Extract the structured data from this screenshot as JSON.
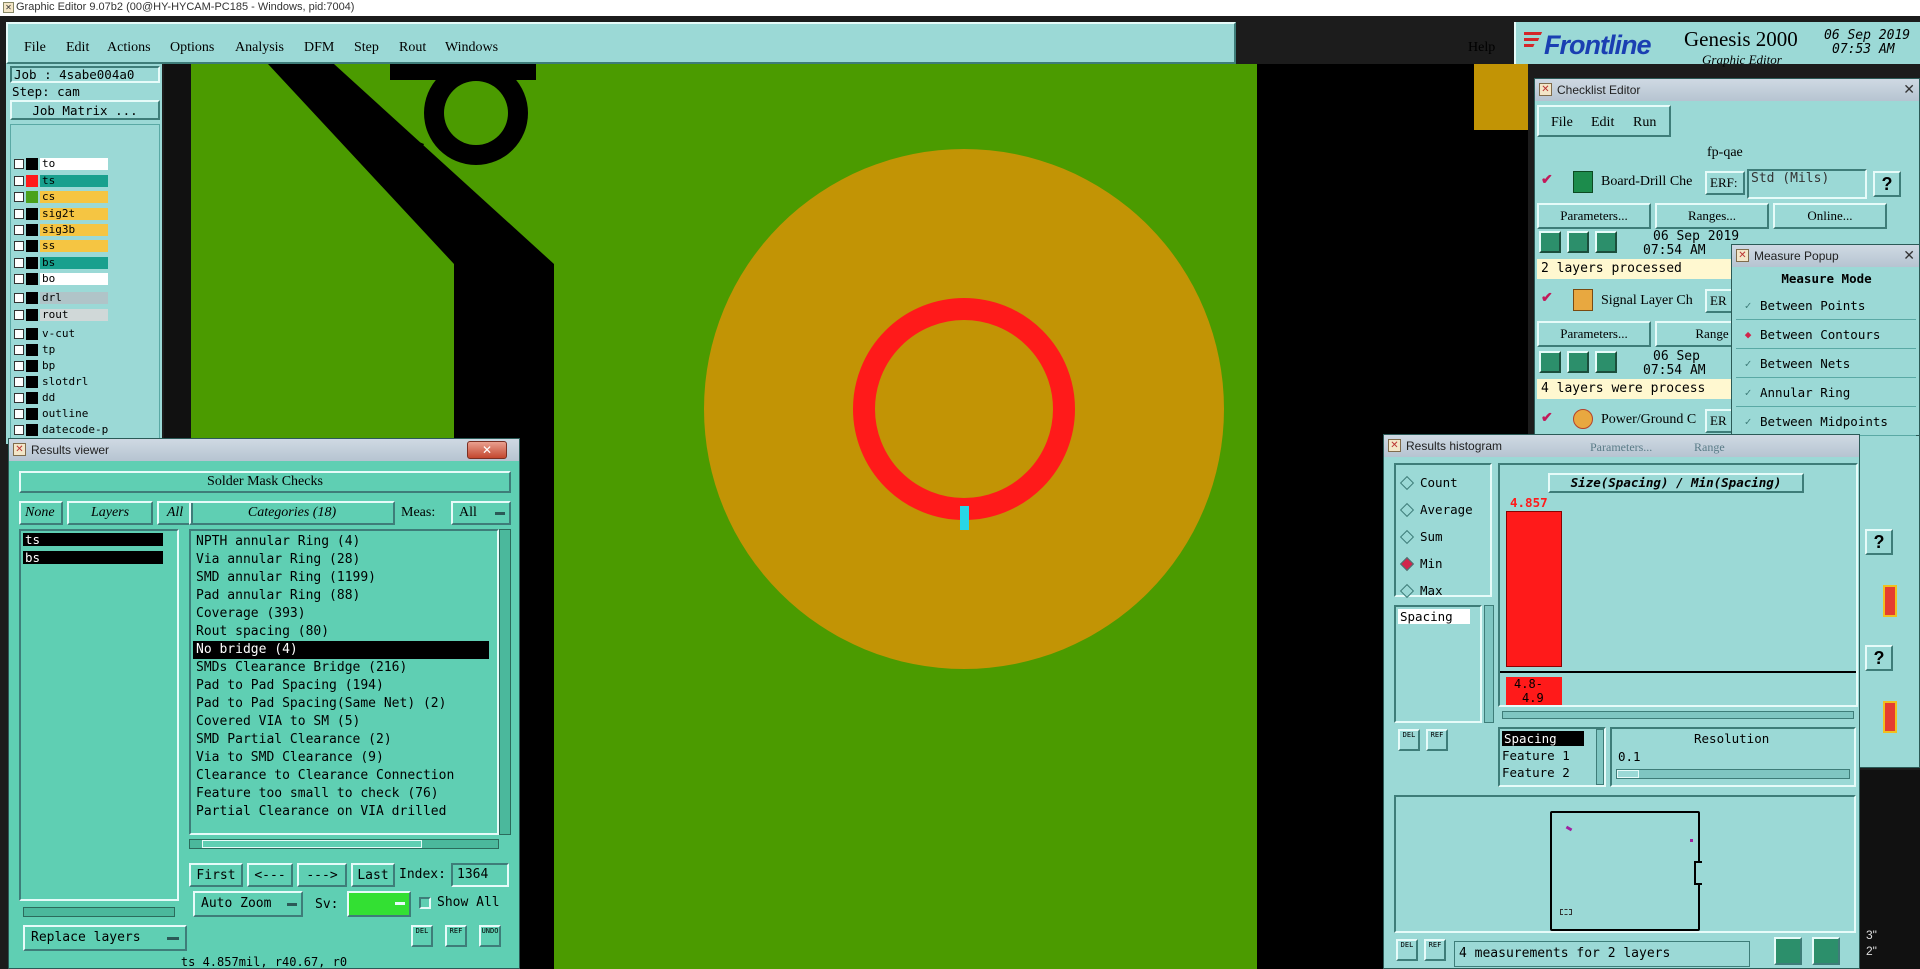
{
  "window": {
    "title": "Graphic Editor 9.07b2 (00@HY-HYCAM-PC185 - Windows, pid:7004)"
  },
  "menu": {
    "items": [
      "File",
      "Edit",
      "Actions",
      "Options",
      "Analysis",
      "DFM",
      "Step",
      "Rout",
      "Windows"
    ],
    "help": "Help"
  },
  "brand": {
    "logo": "Frontline",
    "product": "Genesis 2000",
    "subtitle": "Graphic Editor",
    "date": "06 Sep 2019",
    "time": "07:53 AM"
  },
  "job": {
    "job_label": "Job : 4sabe004a0",
    "step_label": "Step: cam",
    "matrix_button": "Job Matrix ..."
  },
  "layers": [
    {
      "name": "to",
      "color": "#ffffff",
      "swatch": "#000000"
    },
    {
      "name": "ts",
      "color": "#18a08e",
      "swatch": "#ff1a1a"
    },
    {
      "name": "cs",
      "color": "#f5c542",
      "swatch": "#4aa21c"
    },
    {
      "name": "sig2t",
      "color": "#f5c542",
      "swatch": "#000000"
    },
    {
      "name": "sig3b",
      "color": "#f5c542",
      "swatch": "#000000"
    },
    {
      "name": "ss",
      "color": "#f5c542",
      "swatch": "#000000"
    },
    {
      "name": "bs",
      "color": "#18a08e",
      "swatch": "#000000"
    },
    {
      "name": "bo",
      "color": "#ffffff",
      "swatch": "#000000"
    },
    {
      "name": "drl",
      "color": "#b0c4c8",
      "swatch": "#000000"
    },
    {
      "name": "rout",
      "color": "#d0d8d8",
      "swatch": "#000000"
    },
    {
      "name": "v-cut",
      "color": "#9bd9d6",
      "swatch": "#000000"
    },
    {
      "name": "tp",
      "color": "#9bd9d6",
      "swatch": "#000000"
    },
    {
      "name": "bp",
      "color": "#9bd9d6",
      "swatch": "#000000"
    },
    {
      "name": "slotdrl",
      "color": "#9bd9d6",
      "swatch": "#000000"
    },
    {
      "name": "dd",
      "color": "#9bd9d6",
      "swatch": "#000000"
    },
    {
      "name": "outline",
      "color": "#9bd9d6",
      "swatch": "#000000"
    },
    {
      "name": "datecode-pt",
      "color": "#9bd9d6",
      "swatch": "#000000"
    }
  ],
  "results_viewer": {
    "title": "Results viewer",
    "header": "Solder Mask Checks",
    "layer_tabs": {
      "none": "None",
      "layers": "Layers",
      "all": "All"
    },
    "layer_list": [
      "ts",
      "bs"
    ],
    "categories_label": "Categories (18)",
    "meas_label": "Meas:",
    "meas_value": "All",
    "categories": [
      "NPTH annular Ring (4)",
      "Via annular Ring (28)",
      "SMD annular Ring (1199)",
      "Pad annular Ring (88)",
      "Coverage (393)",
      "Rout spacing (80)",
      "No bridge (4)",
      "SMDs Clearance Bridge (216)",
      "Pad to Pad Spacing (194)",
      "Pad to Pad Spacing(Same Net) (2)",
      "Covered VIA to SM (5)",
      "SMD Partial Clearance (2)",
      "Via to SMD Clearance (9)",
      "Clearance to Clearance Connection",
      "Feature too small to check (76)",
      "Partial Clearance on VIA drilled"
    ],
    "selected_category": "No bridge (4)",
    "nav": {
      "first": "First",
      "prev": "<---",
      "next": "--->",
      "last": "Last",
      "index_label": "Index:",
      "index_value": "1364"
    },
    "zoom": "Auto Zoom",
    "sv_label": "Sv:",
    "show_all": "Show All",
    "replace_layers": "Replace layers",
    "status": "ts 4.857mil, r40.67, r0",
    "del": "DEL",
    "ref": "REF",
    "undo": "UNDO"
  },
  "checklist": {
    "title": "Checklist Editor",
    "menu": [
      "File",
      "Edit",
      "Run"
    ],
    "name": "fp-qae",
    "checks": [
      {
        "name": "Board-Drill Che",
        "erf_label": "ERF:",
        "erf_value": "Std (Mils)",
        "date": "06 Sep 2019",
        "time": "07:54 AM",
        "status": "2 layers processed"
      },
      {
        "name": "Signal Layer Ch",
        "erf_label": "ER",
        "date": "06 Sep",
        "time": "07:54 AM",
        "status": "4 layers were process"
      },
      {
        "name": "Power/Ground C",
        "erf_label": "ER"
      }
    ],
    "buttons": {
      "parameters": "Parameters...",
      "ranges": "Ranges...",
      "online": "Online...",
      "ranges_short": "Range"
    },
    "help": "?"
  },
  "measure": {
    "title": "Measure Popup",
    "header": "Measure Mode",
    "modes": [
      "Between Points",
      "Between Contours",
      "Between Nets",
      "Annular Ring",
      "Between Midpoints"
    ],
    "selected": "Between Contours"
  },
  "histogram": {
    "title": "Results histogram",
    "ghost_tabs": [
      "Parameters...",
      "Range"
    ],
    "stats": [
      "Count",
      "Average",
      "Sum",
      "Min",
      "Max"
    ],
    "selected_stat": "Min",
    "list": [
      "Spacing"
    ],
    "chart_label": "Size(Spacing) / Min(Spacing)",
    "bar_value": "4.857",
    "bin_label_a": "4.8-",
    "bin_label_b": "4.9",
    "attributes": [
      "Spacing",
      "Feature 1",
      "Feature 2"
    ],
    "resolution_label": "Resolution",
    "resolution_value": "0.1",
    "status": "4 measurements for 2 layers",
    "del": "DEL",
    "ref": "REF"
  },
  "edge_text": {
    "a": "3\"",
    "b": "2\""
  },
  "colors": {
    "board_green": "#4b9b00",
    "pad_gold": "#c29405",
    "ring_red": "#ff1a1a",
    "track_black": "#000000",
    "ui_teal": "#9bd9d6",
    "panel_teal": "#5fcfb3"
  }
}
